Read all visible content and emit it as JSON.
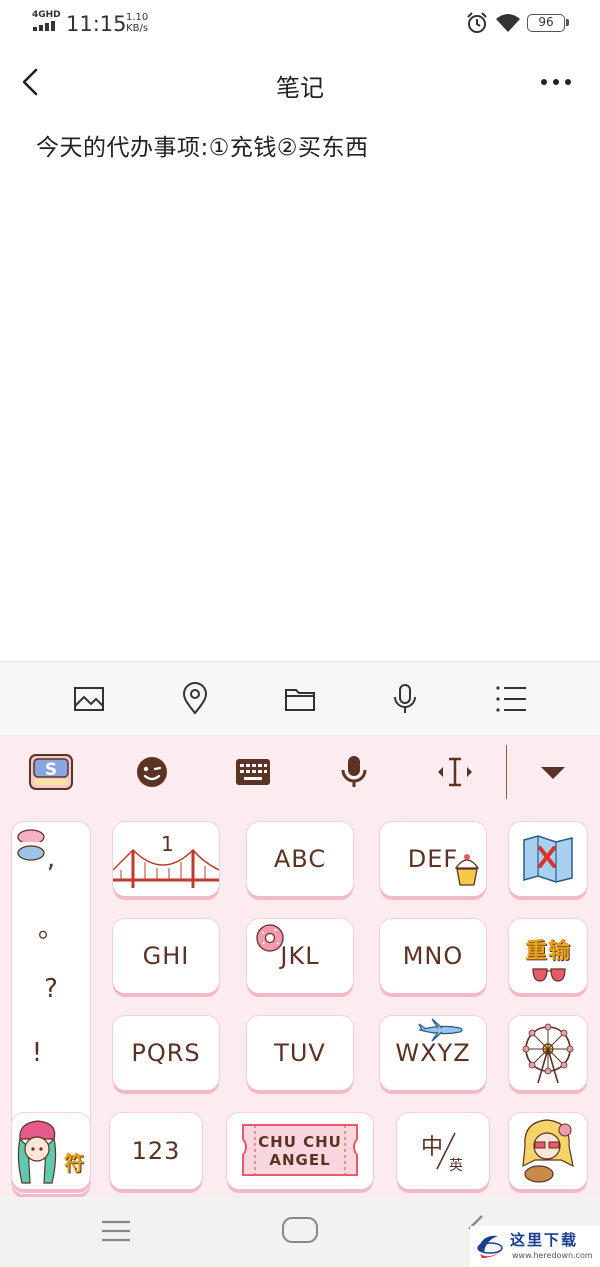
{
  "status_bar": {
    "network": "4GHD",
    "time": "11:15",
    "speed_value": "1.10",
    "speed_unit": "KB/s",
    "battery": "96",
    "icons": [
      "signal-icon",
      "alarm-icon",
      "wifi-icon",
      "battery-icon"
    ]
  },
  "header": {
    "title": "笔记",
    "icons": [
      "back-arrow-icon",
      "more-dots-icon"
    ]
  },
  "note": {
    "content": "今天的代办事项:①充钱②买东西"
  },
  "editor_toolbar": {
    "items": [
      "image-icon",
      "location-pin-icon",
      "folder-icon",
      "microphone-icon",
      "checklist-icon"
    ]
  },
  "keyboard": {
    "top_row": [
      "skin-logo-icon",
      "emoji-icon",
      "keyboard-icon",
      "voice-icon",
      "cursor-move-icon",
      "collapse-arrow-icon"
    ],
    "punctuation": [
      ",",
      "。",
      "?",
      "!"
    ],
    "keys_row1": [
      "1",
      "ABC",
      "DEF"
    ],
    "keys_row2": [
      "GHI",
      "JKL",
      "MNO"
    ],
    "keys_row3": [
      "PQRS",
      "TUV",
      "WXYZ"
    ],
    "side_keys": {
      "row1": "map-sticker-icon",
      "row2_label": "重输",
      "row3": "ferris-wheel-icon"
    },
    "bottom_row": {
      "symbol_label": "符",
      "num_label": "123",
      "space_label": "CHU CHU ANGEL",
      "lang_main": "中",
      "lang_sub": "英"
    },
    "colors": {
      "background": "#fcecef",
      "key_text": "#5a3324",
      "key_shadow": "#f2b9c6"
    }
  },
  "nav_bar": {
    "icons": [
      "menu-lines-icon",
      "home-pill-icon",
      "back-chevron-icon"
    ]
  },
  "watermark": {
    "name": "这里下载",
    "url": "www.heredown.com"
  }
}
